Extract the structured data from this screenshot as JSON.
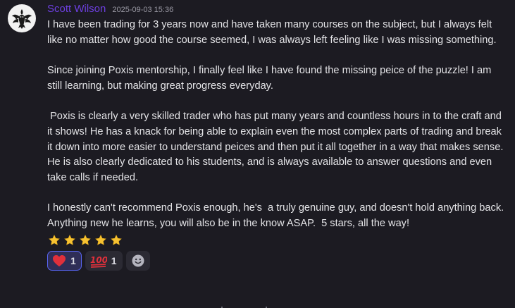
{
  "author": {
    "name": "Scott Wilson",
    "timestamp": "2025-09-03 15:36",
    "name_color": "#6d3fe0"
  },
  "message": {
    "paragraphs": [
      "I have been trading for 3 years now and have taken many courses on the subject, but I always felt like no matter how good the course seemed, I was always left feeling like I was missing something.",
      "Since joining Poxis mentorship, I finally feel like I have found the missing peice of the puzzle! I am still learning, but making great progress everyday.",
      " Poxis is clearly a very skilled trader who has put many years and countless hours in to the craft and it shows! He has a knack for being able to explain even the most complex parts of trading and break it down into more easier to understand peices and then put it all together in a way that makes sense. He is also clearly dedicated to his students, and is always available to answer questions and even take calls if needed.",
      "I honestly can't recommend Poxis enough, he's  a truly genuine guy, and doesn't hold anything back. Anything new he learns, you will also be in the know ASAP.  5 stars, all the way!"
    ],
    "star_icons": [
      "star-icon",
      "star-icon",
      "star-icon",
      "star-icon",
      "star-icon"
    ]
  },
  "reactions": [
    {
      "icon": "heart-icon",
      "count": "1",
      "active": true,
      "color": "#e0303b"
    },
    {
      "icon": "hundred-points-icon",
      "count": "1",
      "active": false,
      "color": "#e0303b"
    }
  ],
  "add_reaction_icon": "smiley-icon",
  "colors": {
    "background": "#1c1b22",
    "star": "#f6c232",
    "reaction_active_border": "#5865f2"
  }
}
